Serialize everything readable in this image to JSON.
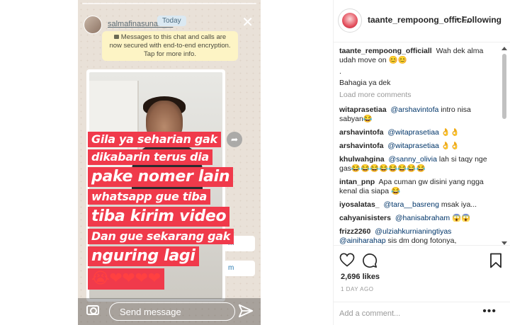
{
  "story": {
    "username": "salmafinasunan_m",
    "today_label": "Today",
    "encryption_notice": "Messages to this chat and calls are now secured with end-to-end encryption. Tap for more info.",
    "video_side_labels": [
      "m",
      "m"
    ],
    "overlay_lines": [
      "Gila ya seharian gak",
      "dikabarin terus dia",
      "pake nomer lain",
      "whatsapp gue tiba",
      "tiba kirim video",
      "Dan gue sekarang gak",
      "nguring lagi"
    ],
    "overlay_emoji": "😭❤❤❤❤",
    "send_placeholder": "Send message",
    "close_symbol": "✕",
    "share_symbol": "➦"
  },
  "post": {
    "username": "taante_rempoong_offici...",
    "separator": "•",
    "follow_label": "Following",
    "caption": {
      "username": "taante_rempoong_officiall",
      "text": "Wah dek alma udah move on 😊😊",
      "line2": ".",
      "line3": "Bahagia ya dek"
    },
    "load_more": "Load more comments",
    "comments": [
      {
        "user": "witaprasetiaa",
        "mention": "@arshavintofa",
        "text": "intro nisa sabyan😂"
      },
      {
        "user": "arshavintofa",
        "mention": "@witaprasetiaa",
        "text": "👌👌"
      },
      {
        "user": "arshavintofa",
        "mention": "@witaprasetiaa",
        "text": "👌👌"
      },
      {
        "user": "khulwahgina",
        "mention": "@sanny_olivia",
        "text": "lah si taqy nge gas😂😂😂😂😂😂😂😂"
      },
      {
        "user": "intan_pnp",
        "mention": "",
        "text": "Apa cuman gw disini yang ngga kenal dia siapa 😂"
      },
      {
        "user": "iyosalatas_",
        "mention": "@tara__basreng",
        "text": "msak iya..."
      },
      {
        "user": "cahyanisisters",
        "mention": "@hanisabraham",
        "text": "😱😱"
      },
      {
        "user": "frizz2260",
        "mention": "@ulziahkurnianingtiyas @ainiharahap",
        "text": "sis dm dong fotonya,"
      }
    ],
    "likes": "2,696 likes",
    "time_ago": "1 DAY AGO",
    "add_comment_placeholder": "Add a comment...",
    "more_label": "•••"
  }
}
